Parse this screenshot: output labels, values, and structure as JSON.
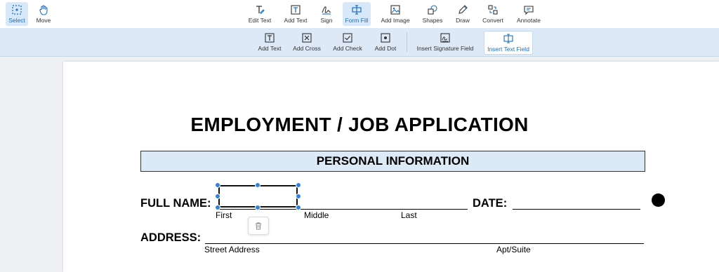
{
  "toolbar": {
    "left_tools": [
      {
        "label": "Select",
        "icon": "select-icon"
      },
      {
        "label": "Move",
        "icon": "hand-icon"
      }
    ],
    "tools": [
      {
        "label": "Edit Text",
        "icon": "edit-text-icon"
      },
      {
        "label": "Add Text",
        "icon": "add-text-icon"
      },
      {
        "label": "Sign",
        "icon": "signature-icon"
      },
      {
        "label": "Form Fill",
        "icon": "form-fill-icon"
      },
      {
        "label": "Add Image",
        "icon": "image-icon"
      },
      {
        "label": "Shapes",
        "icon": "shapes-icon"
      },
      {
        "label": "Draw",
        "icon": "pen-icon"
      },
      {
        "label": "Convert",
        "icon": "convert-icon"
      },
      {
        "label": "Annotate",
        "icon": "comment-icon"
      }
    ],
    "active_tool": "Form Fill",
    "active_left_tool": "Select"
  },
  "subtoolbar": {
    "items": [
      {
        "label": "Add Text",
        "icon": "text-box-icon"
      },
      {
        "label": "Add Cross",
        "icon": "cross-box-icon"
      },
      {
        "label": "Add Check",
        "icon": "check-box-icon"
      },
      {
        "label": "Add Dot",
        "icon": "dot-box-icon"
      },
      {
        "label": "Insert Signature Field",
        "icon": "signature-field-icon"
      },
      {
        "label": "Insert Text Field",
        "icon": "text-field-icon"
      }
    ],
    "active_item": "Insert Text Field"
  },
  "document": {
    "title": "EMPLOYMENT / JOB APPLICATION",
    "section": "PERSONAL INFORMATION",
    "full_name_label": "FULL NAME:",
    "date_label": "DATE:",
    "name_parts": [
      "First",
      "Middle",
      "Last"
    ],
    "address_label": "ADDRESS:",
    "address_parts": [
      "Street Address",
      "Apt/Suite"
    ]
  },
  "colors": {
    "accent": "#2f84d6",
    "active_bg": "#d6e8fa",
    "subbar_bg": "#dde9f6",
    "section_bg": "#dce9f6"
  }
}
